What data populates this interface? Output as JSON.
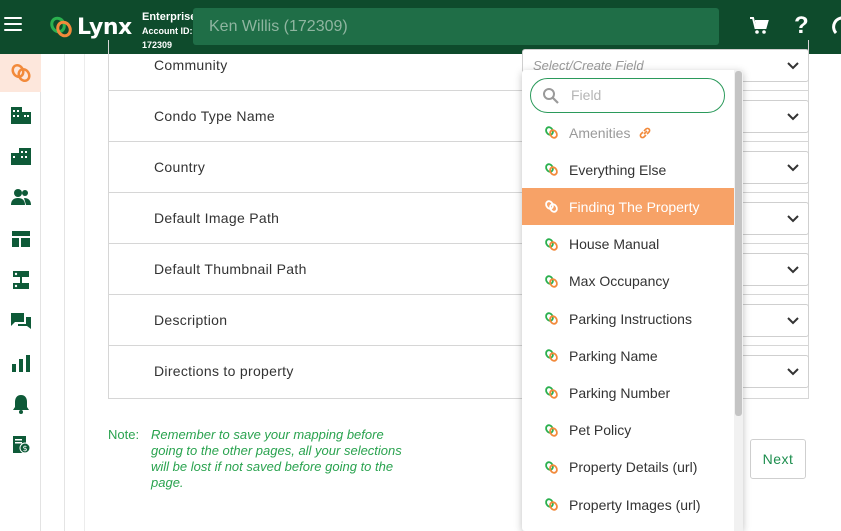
{
  "header": {
    "logo_text": "Lynx",
    "account_type": "Enterprise",
    "account_id_label": "Account ID:",
    "account_id": "172309",
    "user_display": "Ken Willis (172309)"
  },
  "sidebar": {
    "items": [
      {
        "icon": "lynx-logo-icon",
        "active": true
      },
      {
        "icon": "building-icon"
      },
      {
        "icon": "buildings-icon"
      },
      {
        "icon": "users-icon"
      },
      {
        "icon": "layout-icon"
      },
      {
        "icon": "integration-icon"
      },
      {
        "icon": "chat-icon"
      },
      {
        "icon": "bar-chart-icon"
      },
      {
        "icon": "bell-icon"
      },
      {
        "icon": "billing-icon"
      }
    ]
  },
  "mapping": {
    "select_placeholder": "Select/Create Field",
    "rows": [
      {
        "label": "Community"
      },
      {
        "label": "Condo Type Name"
      },
      {
        "label": "Country"
      },
      {
        "label": "Default Image Path"
      },
      {
        "label": "Default Thumbnail Path"
      },
      {
        "label": "Description"
      },
      {
        "label": "Directions to property"
      }
    ]
  },
  "note": {
    "label": "Note:",
    "text": "Remember to save your mapping before going to the other pages, all your selections will be lost if not saved before going to the page."
  },
  "next_label": "Next",
  "dropdown": {
    "search_placeholder": "Field",
    "items": [
      {
        "label": "Amenities",
        "state": "disabled",
        "linked": true
      },
      {
        "label": "Everything Else"
      },
      {
        "label": "Finding The Property",
        "state": "highlight"
      },
      {
        "label": "House Manual"
      },
      {
        "label": "Max Occupancy"
      },
      {
        "label": "Parking Instructions"
      },
      {
        "label": "Parking Name"
      },
      {
        "label": "Parking Number"
      },
      {
        "label": "Pet Policy"
      },
      {
        "label": "Property Details (url)"
      },
      {
        "label": "Property Images (url)"
      }
    ]
  },
  "colors": {
    "header_bg": "#0e4b2c",
    "accent_orange": "#f7a267",
    "accent_green": "#2aa34f"
  }
}
